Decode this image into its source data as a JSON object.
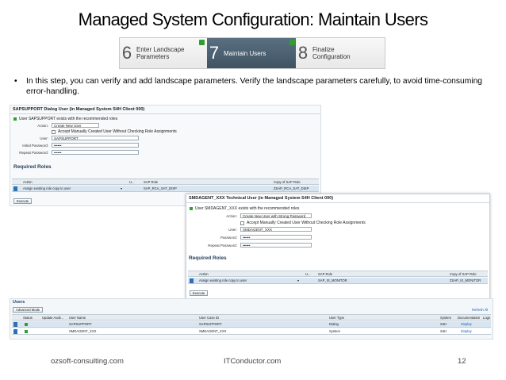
{
  "slide": {
    "title": "Managed System Configuration: Maintain Users",
    "bullet": "In this step, you can verify and add landscape parameters. Verify the landscape parameters carefully, to avoid time-consuming error-handling.",
    "footer_left": "ozsoft-consulting.com",
    "footer_center": "ITConductor.com",
    "page_number": "12"
  },
  "steps": [
    {
      "num": "6",
      "label": "Enter Landscape Parameters"
    },
    {
      "num": "7",
      "label": "Maintain Users"
    },
    {
      "num": "8",
      "label": "Finalize Configuration"
    }
  ],
  "panel1": {
    "header": "SAPSUPPORT Dialog User (in Managed System S4H Client 000)",
    "exists_msg": "User SAPSUPPORT exists with the recommended roles",
    "action_label": "Action:",
    "action_value": "Create New User",
    "accept_label": "Accept Manually Created User Without Checking Role Assignments",
    "user_label": "User:",
    "user_value": "SAPSUPPORT",
    "initial_pw_label": "Initial Password:",
    "initial_pw_value": "••••••",
    "repeat_pw_label": "Repeat Password:",
    "repeat_pw_value": "••••••",
    "roles_title": "Required Roles",
    "col_action": "Action",
    "col_u": "U...",
    "col_sap_role": "SAP Role",
    "col_copy": "Copy of SAP Role",
    "row_action": "Assign existing role copy to user",
    "row_sap_role": "SAP_RCA_SAT_DISP",
    "row_copy": "ZSAP_RCA_SAT_DISP",
    "button": "Execute"
  },
  "panel2": {
    "header": "SMDAGENT_XXX Technical User (in Managed System S4H Client 000)",
    "exists_msg": "User SMDAGENT_XXX exists with the recommended roles",
    "action_label": "Action:",
    "action_value": "Create New User with Strong Password",
    "accept_label": "Accept Manually Created User Without Checking Role Assignments",
    "user_label": "User:",
    "user_value": "SMDAGENT_XXX",
    "pw_label": "Password:",
    "pw_value": "••••••",
    "repeat_pw_label": "Repeat Password:",
    "repeat_pw_value": "••••••",
    "roles_title": "Required Roles",
    "col_action": "Action",
    "col_u": "U...",
    "col_sap_role": "SAP Role",
    "col_copy": "Copy of SAP Role",
    "row_action": "Assign existing role copy to user",
    "row_sap_role": "SAP_IS_MONITOR",
    "row_copy": "ZSAP_IS_MONITOR",
    "button": "Execute"
  },
  "users": {
    "title": "Users",
    "advanced_mode": "Advanced Mode",
    "refresh": "Refresh All",
    "columns": [
      "Status",
      "Update Avail...",
      "User Name",
      "User Case ID",
      "User Type",
      "System",
      "Documentation",
      "Logs"
    ],
    "rows": [
      {
        "name": "SAPSUPPORT",
        "case_id": "SAPSUPPORT",
        "type": "Dialog",
        "system": "S4H",
        "doc": "Display"
      },
      {
        "name": "SMDAGENT_XXX",
        "case_id": "SMDAGENT_XXX",
        "type": "System",
        "system": "S4H",
        "doc": "Display"
      }
    ]
  }
}
